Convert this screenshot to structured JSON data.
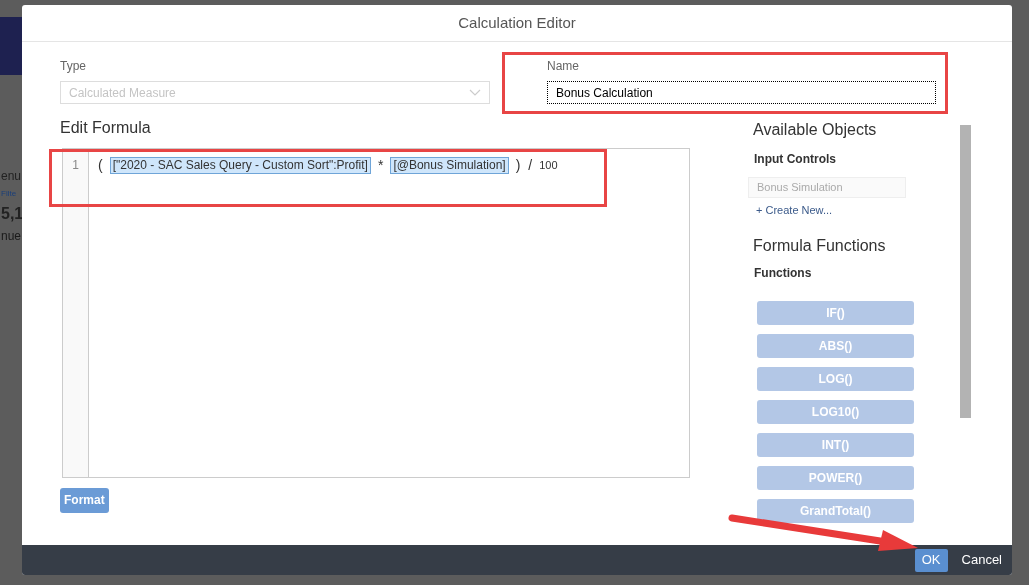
{
  "background": {
    "fragments": [
      {
        "kind": "heading",
        "text": "enu"
      },
      {
        "kind": "link",
        "text": "Filte"
      },
      {
        "kind": "number",
        "text": "5,1"
      },
      {
        "kind": "caption",
        "text": "nue"
      }
    ]
  },
  "dialog": {
    "title": "Calculation Editor",
    "type_field": {
      "label": "Type",
      "value": "Calculated Measure",
      "disabled": true
    },
    "name_field": {
      "label": "Name",
      "value": "Bonus Calculation"
    },
    "formula": {
      "heading": "Edit Formula",
      "lines": [
        {
          "number": "1",
          "parts": [
            {
              "kind": "symbol",
              "text": "("
            },
            {
              "kind": "token",
              "text": "[\"2020 - SAC Sales Query - Custom Sort\":Profit]"
            },
            {
              "kind": "symbol",
              "text": "*"
            },
            {
              "kind": "token",
              "text": "[@Bonus Simulation]"
            },
            {
              "kind": "symbol",
              "text": ")"
            },
            {
              "kind": "symbol",
              "text": "/"
            },
            {
              "kind": "number",
              "text": "100"
            }
          ]
        }
      ]
    },
    "format_button": "Format",
    "available_objects": {
      "heading": "Available Objects",
      "input_controls_label": "Input Controls",
      "input_controls": [
        {
          "label": "Bonus Simulation",
          "disabled": true
        }
      ],
      "create_new": "+ Create New..."
    },
    "formula_functions": {
      "heading": "Formula Functions",
      "functions_label": "Functions",
      "functions": [
        {
          "label": "IF()",
          "disabled": true
        },
        {
          "label": "ABS()",
          "disabled": true
        },
        {
          "label": "LOG()",
          "disabled": true
        },
        {
          "label": "LOG10()",
          "disabled": true
        },
        {
          "label": "INT()",
          "disabled": true
        },
        {
          "label": "POWER()",
          "disabled": true
        },
        {
          "label": "GrandTotal()",
          "disabled": true
        }
      ]
    },
    "buttons": [
      {
        "kind": "primary",
        "label": "OK"
      },
      {
        "kind": "plain",
        "label": "Cancel"
      }
    ]
  }
}
